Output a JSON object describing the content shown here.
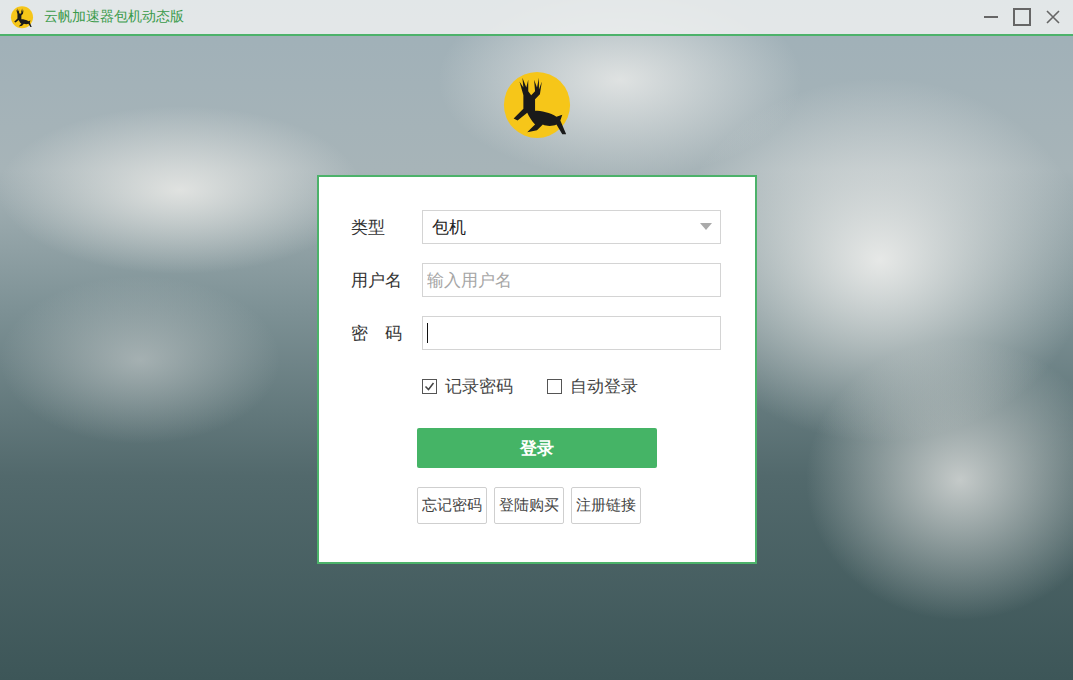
{
  "window": {
    "title": "云帆加速器包机动态版"
  },
  "form": {
    "fields": [
      {
        "label": "类型",
        "kind": "select",
        "value": "包机",
        "placeholder": "",
        "focused": false
      },
      {
        "label": "用户名",
        "kind": "input",
        "value": "",
        "placeholder": "输入用户名",
        "focused": false
      },
      {
        "label": "密　码",
        "kind": "password",
        "value": "",
        "placeholder": "",
        "focused": true
      }
    ],
    "checkboxes": [
      {
        "label": "记录密码",
        "checked": true
      },
      {
        "label": "自动登录",
        "checked": false
      }
    ],
    "submit": "登录",
    "links": [
      "忘记密码",
      "登陆购买",
      "注册链接"
    ]
  }
}
